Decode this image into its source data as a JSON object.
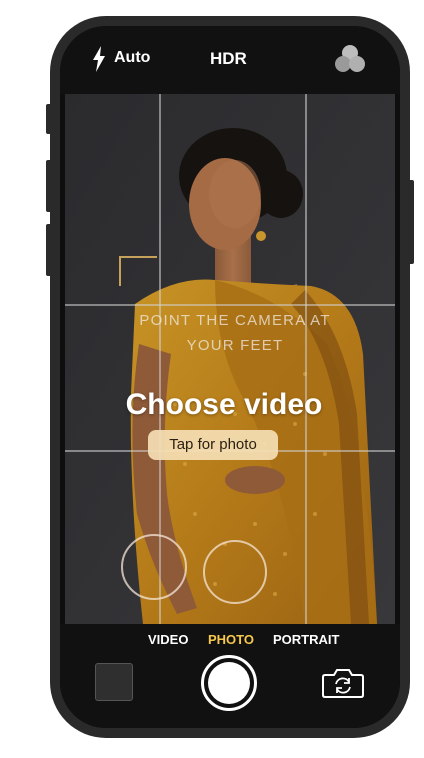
{
  "camera": {
    "flash_mode": "Auto",
    "hdr_label": "HDR",
    "instruction_text": "POINT THE CAMERA AT YOUR FEET",
    "instruction_line1": "POINT THE CAMERA AT",
    "instruction_line2": "YOUR FEET",
    "choose_video_label": "Choose video",
    "tap_photo_label": "Tap for photo"
  },
  "modes": [
    {
      "label": "VIDEO",
      "active": false
    },
    {
      "label": "PHOTO",
      "active": true
    },
    {
      "label": "PORTRAIT",
      "active": false
    }
  ],
  "colors": {
    "active_mode": "#f6c94c",
    "focus_bracket": "#c6a15b",
    "tap_photo_bg": "#f5deb4"
  },
  "icons": {
    "flash": "flash-icon",
    "filters": "filters-icon",
    "switch_camera": "switch-camera-icon",
    "shutter": "shutter-icon",
    "thumbnail": "gallery-thumbnail"
  }
}
